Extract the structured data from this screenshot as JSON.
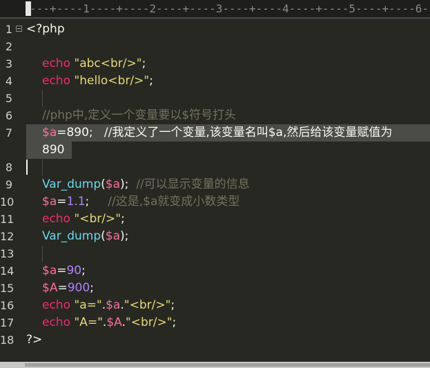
{
  "ruler": {
    "text": "---+----1----+----2----+----3----+----4----+----5----+----6---"
  },
  "lines": [
    {
      "num": "1",
      "parts": [
        {
          "c": "op",
          "t": "<?php"
        }
      ],
      "fold": true
    },
    {
      "num": "2",
      "parts": []
    },
    {
      "num": "3",
      "parts": [
        {
          "c": "kw",
          "t": "echo"
        },
        {
          "c": "op",
          "t": " "
        },
        {
          "c": "str",
          "t": "\"abc"
        },
        {
          "c": "str",
          "t": "<br/>"
        },
        {
          "c": "str",
          "t": "\""
        },
        {
          "c": "op",
          "t": ";"
        }
      ]
    },
    {
      "num": "4",
      "parts": [
        {
          "c": "kw",
          "t": "echo"
        },
        {
          "c": "op",
          "t": " "
        },
        {
          "c": "str",
          "t": "\"hello"
        },
        {
          "c": "str",
          "t": "<br/>"
        },
        {
          "c": "str",
          "t": "\""
        },
        {
          "c": "op",
          "t": ";"
        }
      ]
    },
    {
      "num": "5",
      "parts": []
    },
    {
      "num": "6",
      "parts": [
        {
          "c": "cm",
          "t": "//php中,定义一个变量要以$符号打头"
        }
      ]
    },
    {
      "num": "7",
      "parts": [
        {
          "c": "var",
          "t": "$a"
        },
        {
          "c": "op",
          "t": "=890;   "
        },
        {
          "c": "op",
          "t": "//我定义了一个变量,该变量名叫$a,然后给该变量赋值为"
        }
      ]
    },
    {
      "num": "",
      "parts": [
        {
          "c": "op",
          "t": "890"
        }
      ]
    },
    {
      "num": "8",
      "parts": []
    },
    {
      "num": "9",
      "parts": [
        {
          "c": "fn",
          "t": "Var_dump"
        },
        {
          "c": "op",
          "t": "("
        },
        {
          "c": "var",
          "t": "$a"
        },
        {
          "c": "op",
          "t": ");  "
        },
        {
          "c": "cm",
          "t": "//可以显示变量的信息"
        }
      ]
    },
    {
      "num": "10",
      "parts": [
        {
          "c": "var",
          "t": "$a"
        },
        {
          "c": "op",
          "t": "="
        },
        {
          "c": "num",
          "t": "1.1"
        },
        {
          "c": "op",
          "t": ";     "
        },
        {
          "c": "cm",
          "t": "//这是,$a就变成小数类型"
        }
      ]
    },
    {
      "num": "11",
      "parts": [
        {
          "c": "kw",
          "t": "echo"
        },
        {
          "c": "op",
          "t": " "
        },
        {
          "c": "str",
          "t": "\"<br/>\""
        },
        {
          "c": "op",
          "t": ";"
        }
      ]
    },
    {
      "num": "12",
      "parts": [
        {
          "c": "fn",
          "t": "Var_dump"
        },
        {
          "c": "op",
          "t": "("
        },
        {
          "c": "var",
          "t": "$a"
        },
        {
          "c": "op",
          "t": ");"
        }
      ]
    },
    {
      "num": "13",
      "parts": []
    },
    {
      "num": "14",
      "parts": [
        {
          "c": "var",
          "t": "$a"
        },
        {
          "c": "op",
          "t": "="
        },
        {
          "c": "num",
          "t": "90"
        },
        {
          "c": "op",
          "t": ";"
        }
      ]
    },
    {
      "num": "15",
      "parts": [
        {
          "c": "var",
          "t": "$A"
        },
        {
          "c": "op",
          "t": "="
        },
        {
          "c": "num",
          "t": "900"
        },
        {
          "c": "op",
          "t": ";"
        }
      ]
    },
    {
      "num": "16",
      "parts": [
        {
          "c": "kw",
          "t": "echo"
        },
        {
          "c": "op",
          "t": " "
        },
        {
          "c": "str",
          "t": "\"a=\""
        },
        {
          "c": "op",
          "t": "."
        },
        {
          "c": "var",
          "t": "$a"
        },
        {
          "c": "op",
          "t": "."
        },
        {
          "c": "str",
          "t": "\"<br/>\""
        },
        {
          "c": "op",
          "t": ";"
        }
      ]
    },
    {
      "num": "17",
      "parts": [
        {
          "c": "kw",
          "t": "echo"
        },
        {
          "c": "op",
          "t": " "
        },
        {
          "c": "str",
          "t": "\"A=\""
        },
        {
          "c": "op",
          "t": "."
        },
        {
          "c": "var",
          "t": "$A"
        },
        {
          "c": "op",
          "t": "."
        },
        {
          "c": "str",
          "t": "\"<br/>\""
        },
        {
          "c": "op",
          "t": ";"
        }
      ]
    },
    {
      "num": "18",
      "parts": [
        {
          "c": "op",
          "t": "?>"
        }
      ]
    }
  ],
  "colors": {
    "background": "#272822",
    "keyword": "#f92672",
    "string": "#e6db74",
    "variable": "#fd6fa0",
    "number": "#ae81ff",
    "function": "#66d9ef",
    "comment": "#75715e"
  }
}
